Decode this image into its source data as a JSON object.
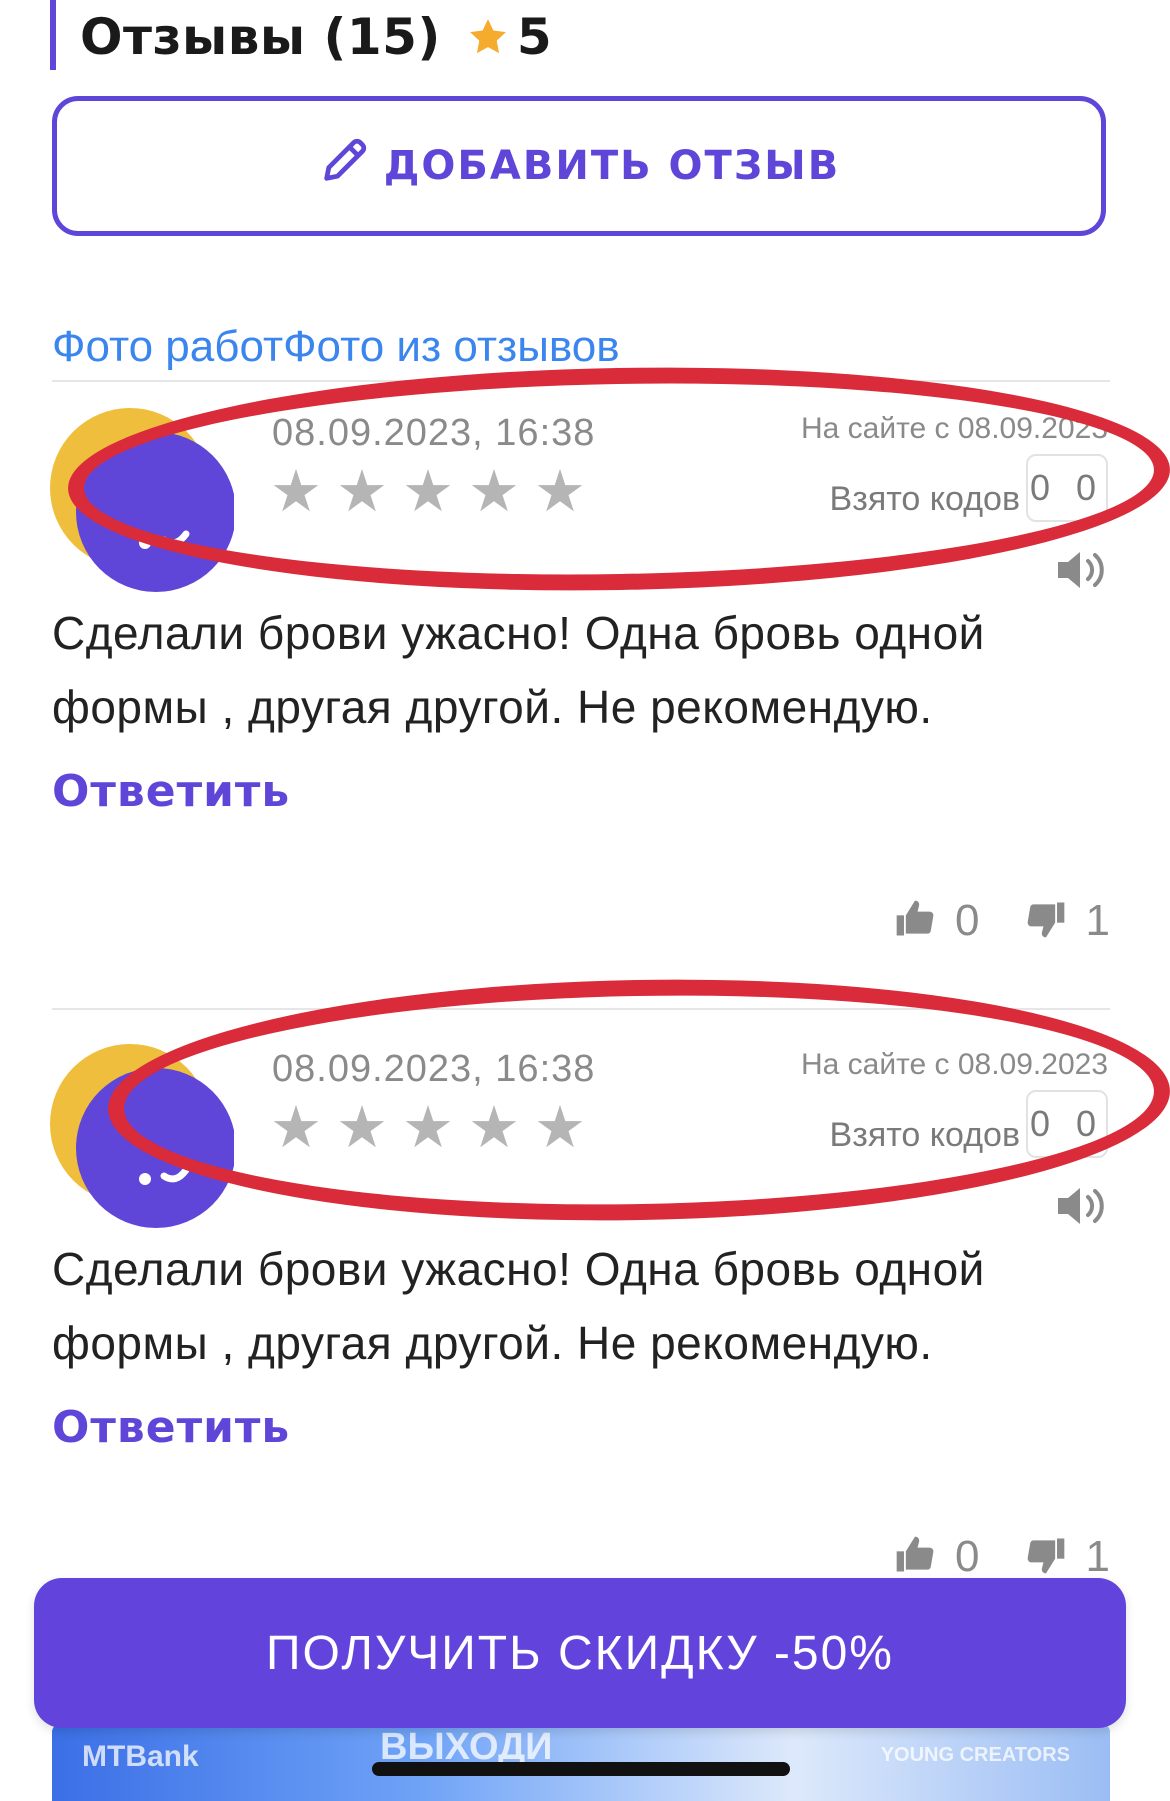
{
  "header": {
    "title": "Отзывы (15)",
    "rating": "5"
  },
  "add_review_label": "ДОБАВИТЬ ОТЗЫВ",
  "photo_tabs": {
    "works": "Фото работ",
    "reviews": "Фото из отзывов"
  },
  "reviews": [
    {
      "date": "08.09.2023, 16:38",
      "rating": 0,
      "member_since": "На сайте с 08.09.2023",
      "codes_label": "Взято кодов",
      "codes_value": "0 0",
      "text": "Сделали брови ужасно! Одна бровь одной формы , другая другой. Не рекомендую.",
      "reply_label": "Ответить",
      "likes": "0",
      "dislikes": "1"
    },
    {
      "date": "08.09.2023, 16:38",
      "rating": 0,
      "member_since": "На сайте с 08.09.2023",
      "codes_label": "Взято кодов",
      "codes_value": "0 0",
      "text": "Сделали брови ужасно! Одна бровь одной формы , другая другой. Не рекомендую.",
      "reply_label": "Ответить",
      "likes": "0",
      "dislikes": "1"
    }
  ],
  "cta_label": "ПОЛУЧИТЬ СКИДКУ -50%",
  "banner": {
    "left": "MTBank",
    "center": "ВЫХОДИ",
    "right": "YOUNG CREATORS"
  },
  "colors": {
    "accent": "#5f46d9",
    "link": "#3a86ee",
    "highlight": "#d92b3a",
    "avatar_yellow": "#efbe3d",
    "avatar_purple": "#5f46d9"
  }
}
